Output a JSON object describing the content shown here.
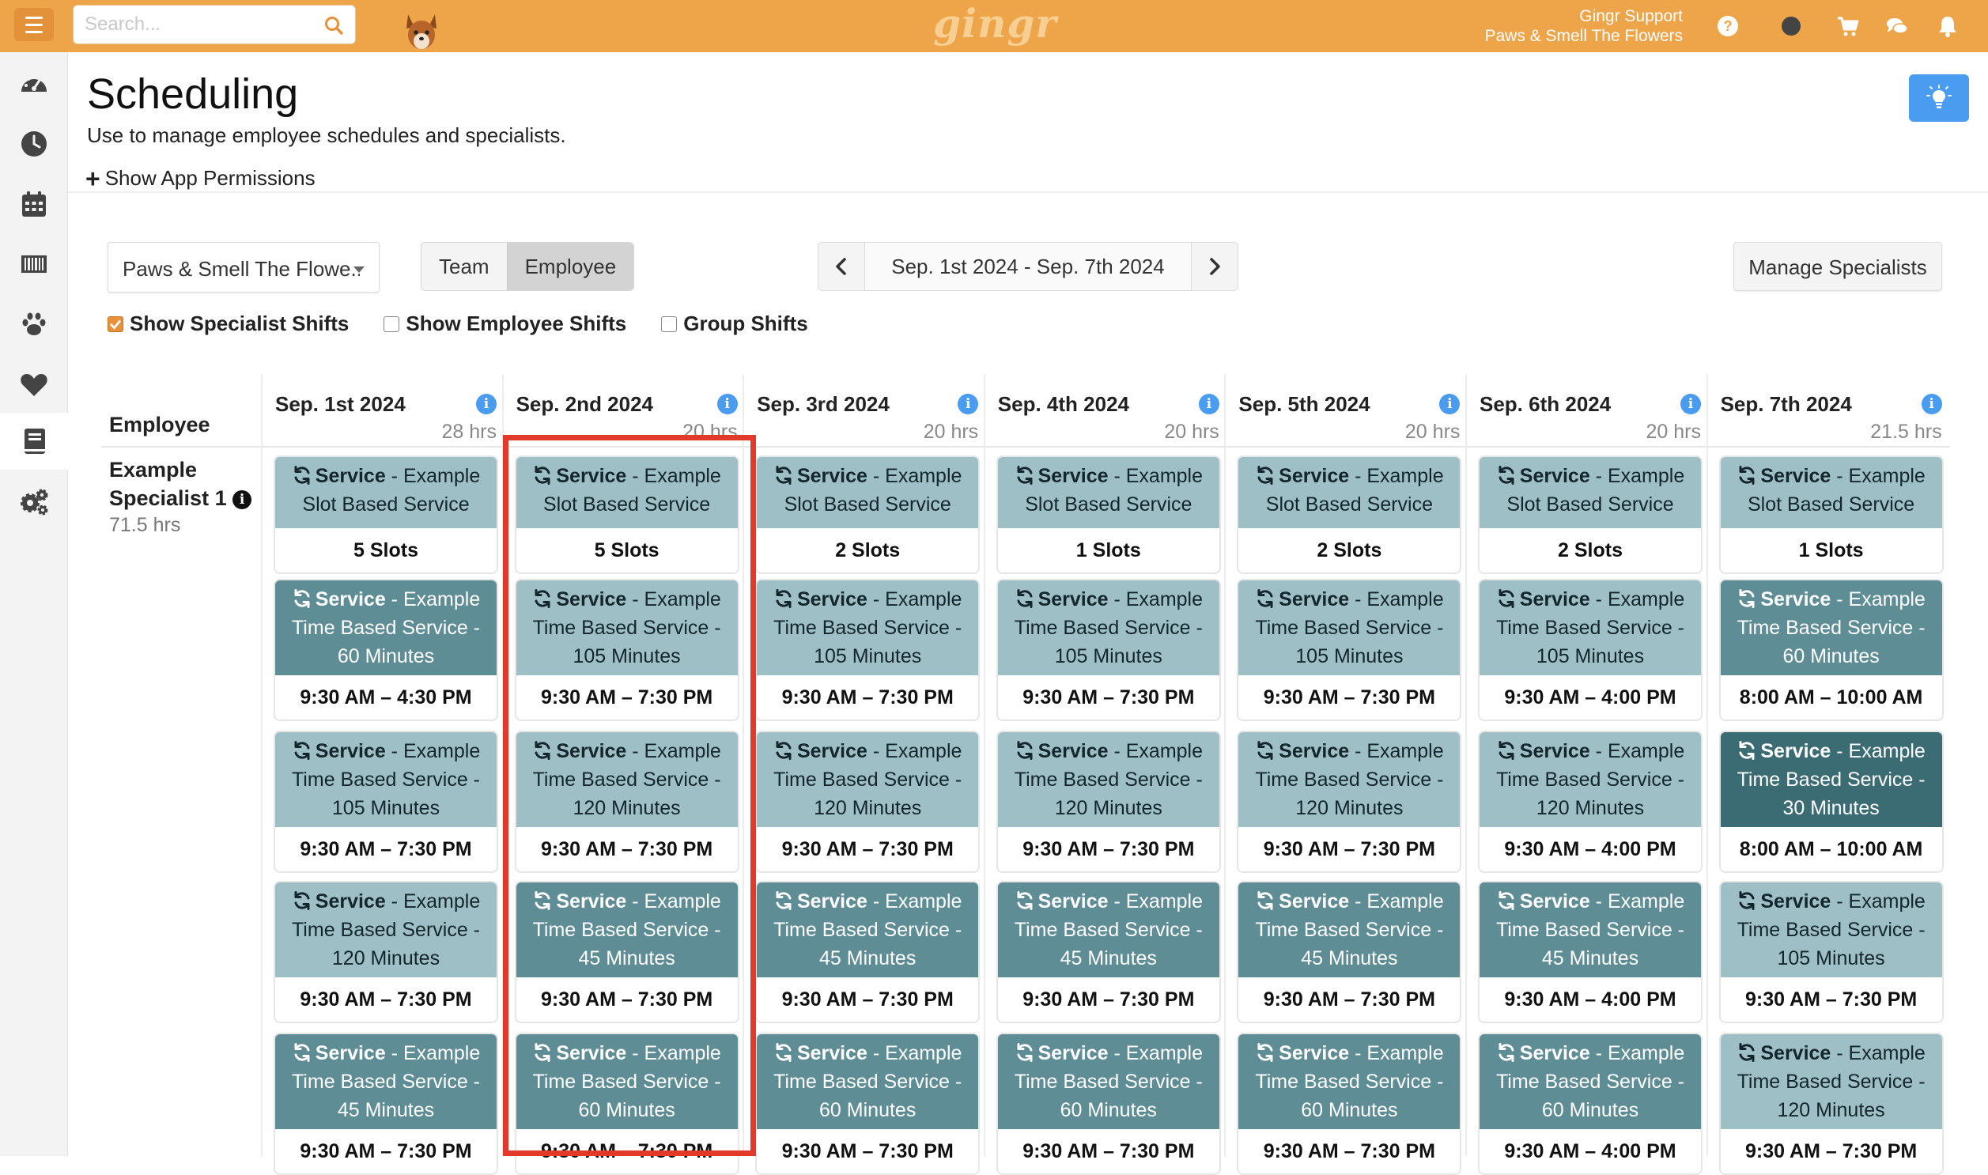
{
  "topbar": {
    "search_placeholder": "Search...",
    "brand": "gingr",
    "account_name": "Gingr Support",
    "account_location": "Paws & Smell The Flowers"
  },
  "header": {
    "title": "Scheduling",
    "subtitle": "Use to manage employee schedules and specialists.",
    "permissions_link": "Show App Permissions"
  },
  "controls": {
    "location": "Paws & Smell The Flowe...",
    "view_team": "Team",
    "view_employee": "Employee",
    "date_range": "Sep. 1st 2024 - Sep. 7th 2024",
    "manage_specialists": "Manage Specialists",
    "show_specialist_shifts": "Show Specialist Shifts",
    "show_employee_shifts": "Show Employee Shifts",
    "group_shifts": "Group Shifts",
    "specialist_checked": true,
    "employee_checked": false,
    "group_checked": false
  },
  "grid": {
    "employee_header": "Employee",
    "employee": {
      "name": "Example Specialist 1",
      "hours": "71.5 hrs"
    },
    "days": [
      {
        "date": "Sep. 1st 2024",
        "hours": "28 hrs"
      },
      {
        "date": "Sep. 2nd 2024",
        "hours": "20 hrs"
      },
      {
        "date": "Sep. 3rd 2024",
        "hours": "20 hrs"
      },
      {
        "date": "Sep. 4th 2024",
        "hours": "20 hrs"
      },
      {
        "date": "Sep. 5th 2024",
        "hours": "20 hrs"
      },
      {
        "date": "Sep. 6th 2024",
        "hours": "20 hrs"
      },
      {
        "date": "Sep. 7th 2024",
        "hours": "21.5 hrs"
      }
    ],
    "service_word": "Service",
    "card_rows": [
      [
        {
          "l1": " - Example",
          "l2": "Slot Based Service",
          "l3": "",
          "bot": "5 Slots",
          "tone": "light"
        },
        {
          "l1": " - Example",
          "l2": "Slot Based Service",
          "l3": "",
          "bot": "5 Slots",
          "tone": "light"
        },
        {
          "l1": " - Example",
          "l2": "Slot Based Service",
          "l3": "",
          "bot": "2 Slots",
          "tone": "light"
        },
        {
          "l1": " - Example",
          "l2": "Slot Based Service",
          "l3": "",
          "bot": "1 Slots",
          "tone": "light"
        },
        {
          "l1": " - Example",
          "l2": "Slot Based Service",
          "l3": "",
          "bot": "2 Slots",
          "tone": "light"
        },
        {
          "l1": " - Example",
          "l2": "Slot Based Service",
          "l3": "",
          "bot": "2 Slots",
          "tone": "light"
        },
        {
          "l1": " - Example",
          "l2": "Slot Based Service",
          "l3": "",
          "bot": "1 Slots",
          "tone": "light"
        }
      ],
      [
        {
          "l1": " - Example",
          "l2": "Time Based Service -",
          "l3": "60 Minutes",
          "bot": "9:30 AM – 4:30 PM",
          "tone": "mid"
        },
        {
          "l1": " - Example",
          "l2": "Time Based Service -",
          "l3": "105 Minutes",
          "bot": "9:30 AM – 7:30 PM",
          "tone": "light"
        },
        {
          "l1": " - Example",
          "l2": "Time Based Service -",
          "l3": "105 Minutes",
          "bot": "9:30 AM – 7:30 PM",
          "tone": "light"
        },
        {
          "l1": " - Example",
          "l2": "Time Based Service -",
          "l3": "105 Minutes",
          "bot": "9:30 AM – 7:30 PM",
          "tone": "light"
        },
        {
          "l1": " - Example",
          "l2": "Time Based Service -",
          "l3": "105 Minutes",
          "bot": "9:30 AM – 7:30 PM",
          "tone": "light"
        },
        {
          "l1": " - Example",
          "l2": "Time Based Service -",
          "l3": "105 Minutes",
          "bot": "9:30 AM – 4:00 PM",
          "tone": "light"
        },
        {
          "l1": " - Example",
          "l2": "Time Based Service -",
          "l3": "60 Minutes",
          "bot": "8:00 AM – 10:00 AM",
          "tone": "mid"
        }
      ],
      [
        {
          "l1": " - Example",
          "l2": "Time Based Service -",
          "l3": "105 Minutes",
          "bot": "9:30 AM – 7:30 PM",
          "tone": "light"
        },
        {
          "l1": " - Example",
          "l2": "Time Based Service -",
          "l3": "120 Minutes",
          "bot": "9:30 AM – 7:30 PM",
          "tone": "light"
        },
        {
          "l1": " - Example",
          "l2": "Time Based Service -",
          "l3": "120 Minutes",
          "bot": "9:30 AM – 7:30 PM",
          "tone": "light"
        },
        {
          "l1": " - Example",
          "l2": "Time Based Service -",
          "l3": "120 Minutes",
          "bot": "9:30 AM – 7:30 PM",
          "tone": "light"
        },
        {
          "l1": " - Example",
          "l2": "Time Based Service -",
          "l3": "120 Minutes",
          "bot": "9:30 AM – 7:30 PM",
          "tone": "light"
        },
        {
          "l1": " - Example",
          "l2": "Time Based Service -",
          "l3": "120 Minutes",
          "bot": "9:30 AM – 4:00 PM",
          "tone": "light"
        },
        {
          "l1": " - Example",
          "l2": "Time Based Service -",
          "l3": "30 Minutes",
          "bot": "8:00 AM – 10:00 AM",
          "tone": "dark"
        }
      ],
      [
        {
          "l1": " - Example",
          "l2": "Time Based Service -",
          "l3": "120 Minutes",
          "bot": "9:30 AM – 7:30 PM",
          "tone": "light"
        },
        {
          "l1": " - Example",
          "l2": "Time Based Service -",
          "l3": "45 Minutes",
          "bot": "9:30 AM – 7:30 PM",
          "tone": "mid"
        },
        {
          "l1": " - Example",
          "l2": "Time Based Service -",
          "l3": "45 Minutes",
          "bot": "9:30 AM – 7:30 PM",
          "tone": "mid"
        },
        {
          "l1": " - Example",
          "l2": "Time Based Service -",
          "l3": "45 Minutes",
          "bot": "9:30 AM – 7:30 PM",
          "tone": "mid"
        },
        {
          "l1": " - Example",
          "l2": "Time Based Service -",
          "l3": "45 Minutes",
          "bot": "9:30 AM – 7:30 PM",
          "tone": "mid"
        },
        {
          "l1": " - Example",
          "l2": "Time Based Service -",
          "l3": "45 Minutes",
          "bot": "9:30 AM – 4:00 PM",
          "tone": "mid"
        },
        {
          "l1": " - Example",
          "l2": "Time Based Service -",
          "l3": "105 Minutes",
          "bot": "9:30 AM – 7:30 PM",
          "tone": "light"
        }
      ],
      [
        {
          "l1": " - Example",
          "l2": "Time Based Service -",
          "l3": "45 Minutes",
          "bot": "9:30 AM – 7:30 PM",
          "tone": "mid"
        },
        {
          "l1": " - Example",
          "l2": "Time Based Service -",
          "l3": "60 Minutes",
          "bot": "9:30 AM – 7:30 PM",
          "tone": "mid"
        },
        {
          "l1": " - Example",
          "l2": "Time Based Service -",
          "l3": "60 Minutes",
          "bot": "9:30 AM – 7:30 PM",
          "tone": "mid"
        },
        {
          "l1": " - Example",
          "l2": "Time Based Service -",
          "l3": "60 Minutes",
          "bot": "9:30 AM – 7:30 PM",
          "tone": "mid"
        },
        {
          "l1": " - Example",
          "l2": "Time Based Service -",
          "l3": "60 Minutes",
          "bot": "9:30 AM – 7:30 PM",
          "tone": "mid"
        },
        {
          "l1": " - Example",
          "l2": "Time Based Service -",
          "l3": "60 Minutes",
          "bot": "9:30 AM – 4:00 PM",
          "tone": "mid"
        },
        {
          "l1": " - Example",
          "l2": "Time Based Service -",
          "l3": "120 Minutes",
          "bot": "9:30 AM – 7:30 PM",
          "tone": "light"
        }
      ]
    ]
  },
  "colors": {
    "topbar": "#eea54a",
    "accent_blue": "#4a9cf0",
    "card_light": "#9ebfc6",
    "card_mid": "#5f8d96",
    "card_dark": "#3b6b73",
    "highlight": "#e23a2a"
  },
  "icons": {
    "sidebar": [
      "dashboard-icon",
      "clock-icon",
      "calendar-icon",
      "barcode-icon",
      "paw-icon",
      "heart-icon",
      "book-icon",
      "gears-icon"
    ],
    "topbar": [
      "help-icon",
      "status-dot-icon",
      "cart-icon",
      "chat-icon",
      "bell-icon"
    ],
    "card": "refresh-icon"
  }
}
